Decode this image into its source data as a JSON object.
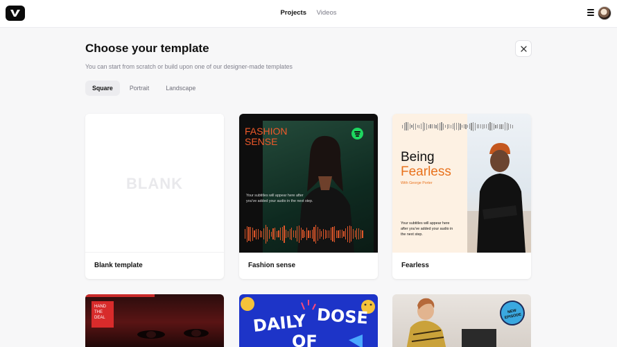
{
  "nav": {
    "projects_label": "Projects",
    "videos_label": "Videos"
  },
  "header": {
    "title": "Choose your template",
    "subtitle": "You can start from scratch or build upon one of our designer-made templates"
  },
  "tabs": [
    {
      "label": "Square",
      "active": true
    },
    {
      "label": "Portrait",
      "active": false
    },
    {
      "label": "Landscape",
      "active": false
    }
  ],
  "templates": [
    {
      "name": "Blank template",
      "thumb_text": "BLANK"
    },
    {
      "name": "Fashion sense",
      "thumb_title_1": "FASHION",
      "thumb_title_2": "SENSE",
      "subtitle_line_1": "Your subtitles will appear here after",
      "subtitle_line_2": "you've added your audio in the next step."
    },
    {
      "name": "Fearless",
      "thumb_title_1": "Being",
      "thumb_title_2": "Fearless",
      "thumb_byline": "With George Porter",
      "subtitle_line_1": "Your subtitles will appear here",
      "subtitle_line_2": "after you've added your audio in",
      "subtitle_line_3": "the next step."
    }
  ],
  "partial_templates": [
    {
      "thumb_text_1": "HAND",
      "thumb_text_2": "THE",
      "thumb_text_3": "DEAL"
    },
    {
      "thumb_text_1": "DAILY",
      "thumb_text_2": "DOSE",
      "thumb_text_3": "OF"
    },
    {
      "badge_1": "NEW",
      "badge_2": "EPISODE"
    }
  ],
  "icons": {
    "logo": "v-logo-icon",
    "menu": "hamburger-menu-icon",
    "close": "close-icon",
    "spotify": "spotify-icon"
  },
  "colors": {
    "accent_orange": "#e8721d",
    "fashion_orange": "#f05a2a",
    "hand_red": "#d82b2b",
    "daily_blue": "#1d34c8"
  }
}
